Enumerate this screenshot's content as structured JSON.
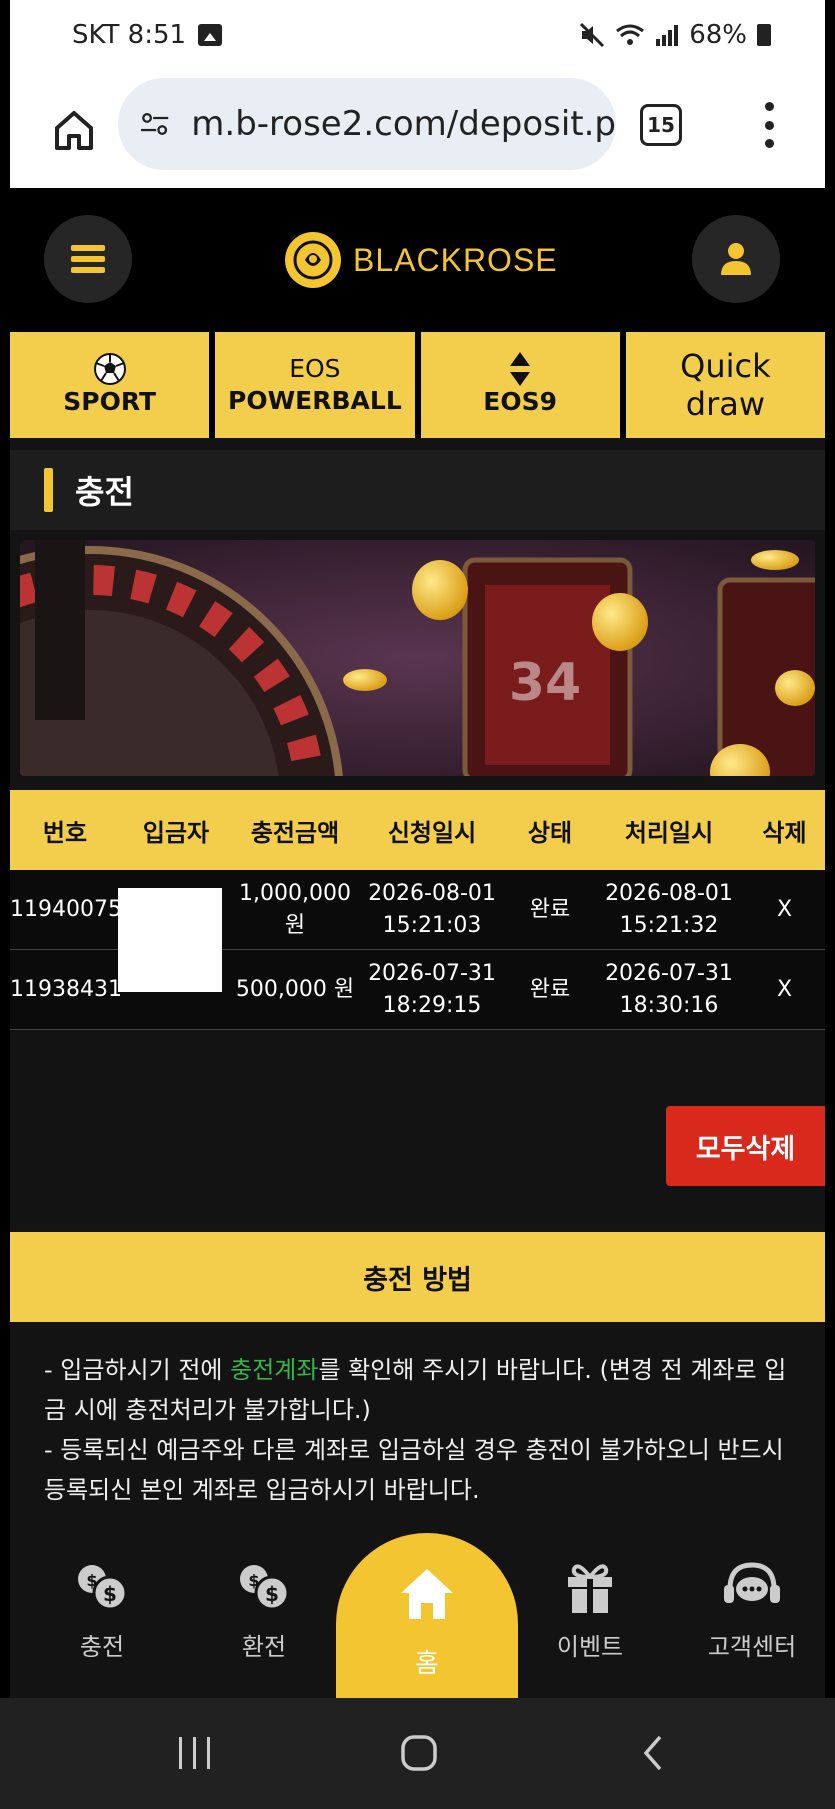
{
  "status_bar": {
    "carrier_time": "SKT 8:51",
    "battery": "68%"
  },
  "browser": {
    "url": "m.b-rose2.com/deposit.p",
    "tab_count": "15"
  },
  "site": {
    "logo_text": "BLACKROSE",
    "game_nav": [
      {
        "label": "SPORT",
        "icon": "soccer-ball-icon"
      },
      {
        "label_line1": "EOS",
        "label_line2": "POWERBALL"
      },
      {
        "label": "EOS9",
        "icon": "up-down-arrow-icon"
      },
      {
        "label_line1": "Quick",
        "label_line2": "draw"
      }
    ],
    "section_title": "충전",
    "banner": {
      "number": "34"
    },
    "table": {
      "headers": [
        "번호",
        "입금자",
        "충전금액",
        "신청일시",
        "상태",
        "처리일시",
        "삭제"
      ],
      "rows": [
        {
          "id": "11940075",
          "depositor": "",
          "amount_line1": "1,000,000",
          "amount_line2": "원",
          "request_date": "2026-08-01",
          "request_time": "15:21:03",
          "status": "완료",
          "process_date": "2026-08-01",
          "process_time": "15:21:32",
          "delete": "X"
        },
        {
          "id": "11938431",
          "depositor": "",
          "amount_line1": "500,000 원",
          "amount_line2": "",
          "request_date": "2026-07-31",
          "request_time": "18:29:15",
          "status": "완료",
          "process_date": "2026-07-31",
          "process_time": "18:30:16",
          "delete": "X"
        }
      ]
    },
    "delete_all_label": "모두삭제",
    "method": {
      "title": "충전 방법",
      "line1_pre": "- 입금하시기 전에 ",
      "line1_highlight": "충전계좌",
      "line1_post": "를 확인해 주시기 바랍니다. (변경 전 계좌로 입금 시에 충전처리가 불가합니다.)",
      "line2": "- 등록되신 예금주와 다른 계좌로 입금하실 경우 충전이 불가하오니 반드시 등록되신 본인 계좌로 입금하시기 바랍니다."
    },
    "bottom_nav": [
      {
        "label": "충전"
      },
      {
        "label": "환전"
      },
      {
        "label": "홈"
      },
      {
        "label": "이벤트"
      },
      {
        "label": "고객센터"
      }
    ]
  },
  "colors": {
    "accent_yellow": "#f3ce4c",
    "delete_red": "#d9291c",
    "highlight_green": "#36b44a"
  }
}
